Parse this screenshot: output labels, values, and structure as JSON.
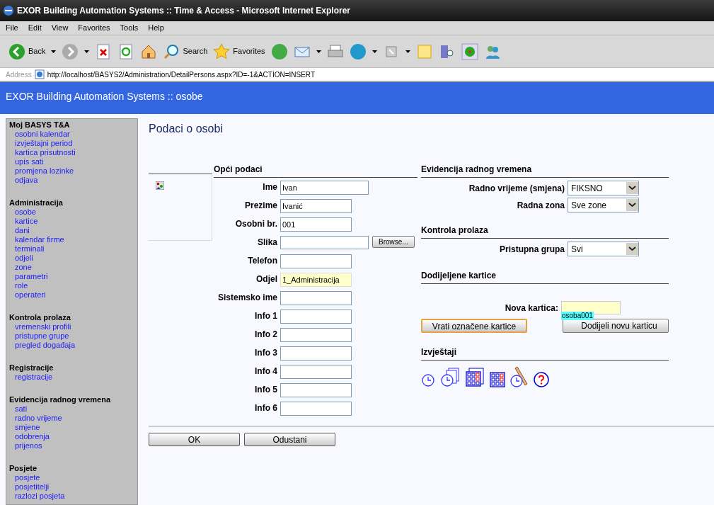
{
  "window": {
    "title": "EXOR Building Automation Systems :: Time & Access - Microsoft Internet Explorer"
  },
  "menu": [
    "File",
    "Edit",
    "View",
    "Favorites",
    "Tools",
    "Help"
  ],
  "toolbar": {
    "back": "Back",
    "search": "Search",
    "favorites": "Favorites"
  },
  "address": {
    "label": "Address",
    "url": "http://localhost/BASYS2/Administration/DetailPersons.aspx?ID=-1&ACTION=INSERT"
  },
  "header": {
    "title": "EXOR Building Automation Systems :: osobe"
  },
  "sidebar": [
    {
      "title": "Moj BASYS T&A",
      "items": [
        "osobni kalendar",
        "izvještajni period",
        "kartica prisutnosti",
        "upis sati",
        "promjena lozinke",
        "odjava"
      ]
    },
    {
      "title": "Administracija",
      "items": [
        "osobe",
        "kartice",
        "dani",
        "kalendar firme",
        "terminali",
        "odjeli",
        "zone",
        "parametri",
        "role",
        "operateri"
      ]
    },
    {
      "title": "Kontrola prolaza",
      "items": [
        "vremenski profili",
        "pristupne grupe",
        "pregled događaja"
      ]
    },
    {
      "title": "Registracije",
      "items": [
        "registracije"
      ]
    },
    {
      "title": "Evidencija radnog vremena",
      "items": [
        "sati",
        "radno vrijeme",
        "smjene",
        "odobrenja",
        "prijenos"
      ]
    },
    {
      "title": "Posjete",
      "items": [
        "posjete",
        "posjetitelji",
        "razlozi posjeta"
      ]
    }
  ],
  "page_title": "Podaci o osobi",
  "general": {
    "heading": "Opći podaci",
    "fields": [
      {
        "label": "Ime",
        "value": "Ivan",
        "kind": "wide"
      },
      {
        "label": "Prezime",
        "value": "Ivanić",
        "kind": "text"
      },
      {
        "label": "Osobni br.",
        "value": "001",
        "kind": "text"
      },
      {
        "label": "Slika",
        "kind": "file",
        "button": "Browse..."
      },
      {
        "label": "Telefon",
        "kind": "text"
      },
      {
        "label": "Odjel",
        "value": "1_Administracija",
        "kind": "readonly"
      },
      {
        "label": "Sistemsko ime",
        "kind": "text"
      },
      {
        "label": "Info 1",
        "kind": "text"
      },
      {
        "label": "Info 2",
        "kind": "text"
      },
      {
        "label": "Info 3",
        "kind": "text"
      },
      {
        "label": "Info 4",
        "kind": "text"
      },
      {
        "label": "Info 5",
        "kind": "text"
      },
      {
        "label": "Info 6",
        "kind": "text"
      }
    ]
  },
  "work_time": {
    "heading": "Evidencija radnog vremena",
    "selects": [
      {
        "label": "Radno vrijeme (smjena)",
        "value": "FIKSNO"
      },
      {
        "label": "Radna zona",
        "value": "Sve zone"
      }
    ]
  },
  "access": {
    "heading": "Kontrola prolaza",
    "selects": [
      {
        "label": "Pristupna grupa",
        "value": "Svi"
      }
    ]
  },
  "cards": {
    "heading": "Dodijeljene kartice",
    "new_card_label": "Nova kartica:",
    "tooltip": "osoba001",
    "return_button": "Vrati označene kartice",
    "assign_button": "Dodijeli novu karticu"
  },
  "reports": {
    "heading": "Izvještaji"
  },
  "buttons": [
    "OK",
    "Odustani"
  ]
}
